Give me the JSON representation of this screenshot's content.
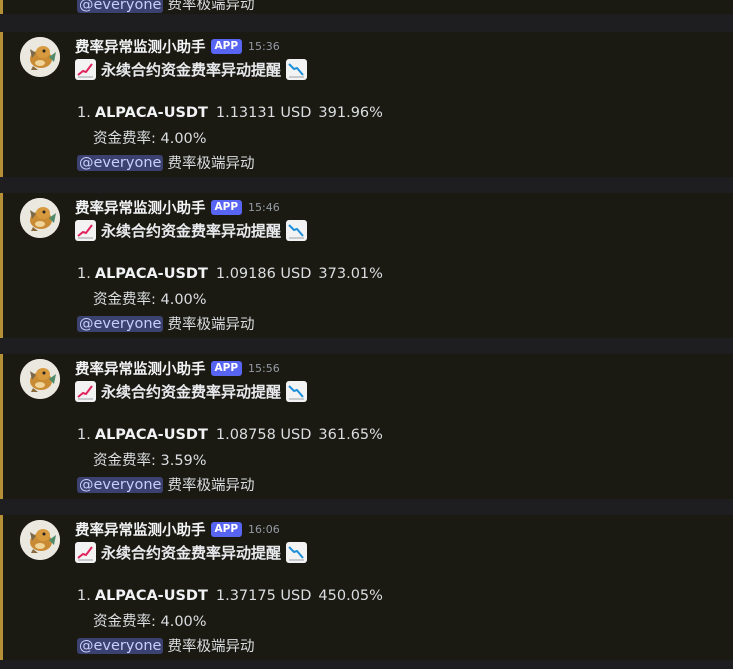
{
  "top_partial": {
    "mention": "@everyone",
    "text": "费率极端异动"
  },
  "messages": [
    {
      "author": "费率异常监测小助手",
      "tag": "APP",
      "time": "15:36",
      "title": "永续合约资金费率异动提醒",
      "item_number": "1.",
      "symbol": "ALPACA-USDT",
      "price": "1.13131 USD",
      "change": "391.96%",
      "rate": "资金费率: 4.00%",
      "mention": "@everyone",
      "footer": "费率极端异动"
    },
    {
      "author": "费率异常监测小助手",
      "tag": "APP",
      "time": "15:46",
      "title": "永续合约资金费率异动提醒",
      "item_number": "1.",
      "symbol": "ALPACA-USDT",
      "price": "1.09186 USD",
      "change": "373.01%",
      "rate": "资金费率: 4.00%",
      "mention": "@everyone",
      "footer": "费率极端异动"
    },
    {
      "author": "费率异常监测小助手",
      "tag": "APP",
      "time": "15:56",
      "title": "永续合约资金费率异动提醒",
      "item_number": "1.",
      "symbol": "ALPACA-USDT",
      "price": "1.08758 USD",
      "change": "361.65%",
      "rate": "资金费率: 3.59%",
      "mention": "@everyone",
      "footer": "费率极端异动"
    },
    {
      "author": "费率异常监测小助手",
      "tag": "APP",
      "time": "16:06",
      "title": "永续合约资金费率异动提醒",
      "item_number": "1.",
      "symbol": "ALPACA-USDT",
      "price": "1.37175 USD",
      "change": "450.05%",
      "rate": "资金费率: 4.00%",
      "mention": "@everyone",
      "footer": "费率极端异动"
    }
  ],
  "icons": {
    "title_left": "chart-increasing-emoji",
    "title_right": "chart-decreasing-emoji",
    "avatar": "bot-avatar-icon"
  },
  "colors": {
    "accent_bar": "#b69037",
    "app_tag": "#5865f2",
    "mention_bg": "#3c4270",
    "mention_text": "#c9cdfb",
    "chart_up": "#e0245e",
    "chart_down": "#1d8fd8"
  }
}
